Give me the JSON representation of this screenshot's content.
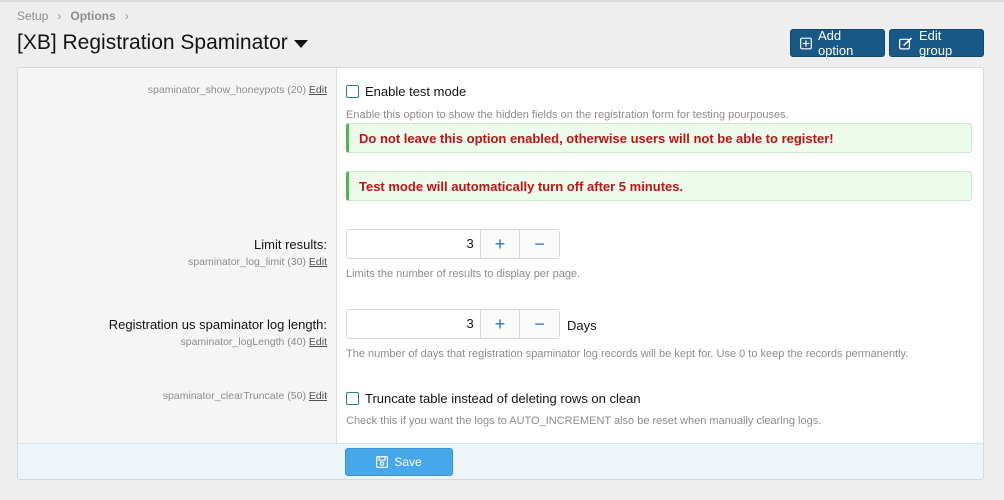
{
  "breadcrumb": {
    "items": [
      "Setup",
      "Options"
    ]
  },
  "page": {
    "title": "[XB] Registration Spaminator"
  },
  "header_buttons": {
    "add_option": "Add option",
    "edit_group": "Edit group"
  },
  "common": {
    "edit_link": "Edit"
  },
  "options": {
    "show_honeypots": {
      "id": "spaminator_show_honeypots (20)",
      "checkbox_label": "Enable test mode",
      "checked": false,
      "hint": "Enable this option to show the hidden fields on the registration form for testing pourpouses.",
      "notices": [
        "Do not leave this option enabled, otherwise users will not be able to register!",
        "Test mode will automatically turn off after 5 minutes."
      ]
    },
    "log_limit": {
      "label": "Limit results:",
      "id": "spaminator_log_limit (30)",
      "value": "3",
      "hint": "Limits the number of results to display per page."
    },
    "log_length": {
      "label": "Registration us spaminator log length:",
      "id": "spaminator_logLength (40)",
      "value": "3",
      "units": "Days",
      "hint": "The number of days that registration spaminator log records will be kept for. Use 0 to keep the records permanently."
    },
    "clear_truncate": {
      "id": "spaminator_clearTruncate (50)",
      "checkbox_label": "Truncate table instead of deleting rows on clean",
      "checked": false,
      "hint": "Check this if you want the logs to AUTO_INCREMENT also be reset when manually clearing logs."
    }
  },
  "footer": {
    "save_label": "Save"
  },
  "colors": {
    "header_button": "#185886",
    "save_button": "#47a7eb",
    "accent": "#2577b1",
    "notice_text": "#c41212",
    "notice_border": "#4bb84b"
  }
}
